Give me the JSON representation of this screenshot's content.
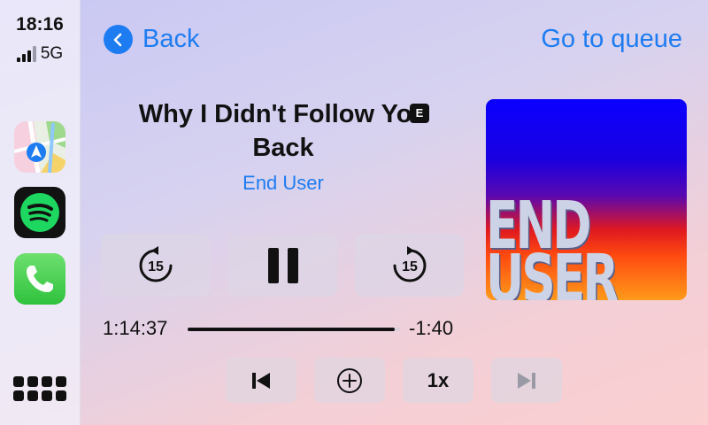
{
  "status": {
    "time": "18:16",
    "network": "5G"
  },
  "sidebar": {
    "apps": [
      {
        "name": "maps-icon"
      },
      {
        "name": "spotify-icon"
      },
      {
        "name": "phone-icon"
      }
    ]
  },
  "header": {
    "back_label": "Back",
    "queue_label": "Go to queue"
  },
  "track": {
    "title": "Why I Didn't Follow You Back",
    "explicit_badge": "E",
    "artist": "End User",
    "artwork_text_line1": "END",
    "artwork_text_line2": "USER"
  },
  "playback": {
    "rewind_seconds": "15",
    "forward_seconds": "15",
    "elapsed": "1:14:37",
    "remaining": "-1:40",
    "progress_fraction": 0.975,
    "speed_label": "1x"
  },
  "colors": {
    "accent": "#1e7cf2",
    "spotify_green": "#1ed760"
  }
}
